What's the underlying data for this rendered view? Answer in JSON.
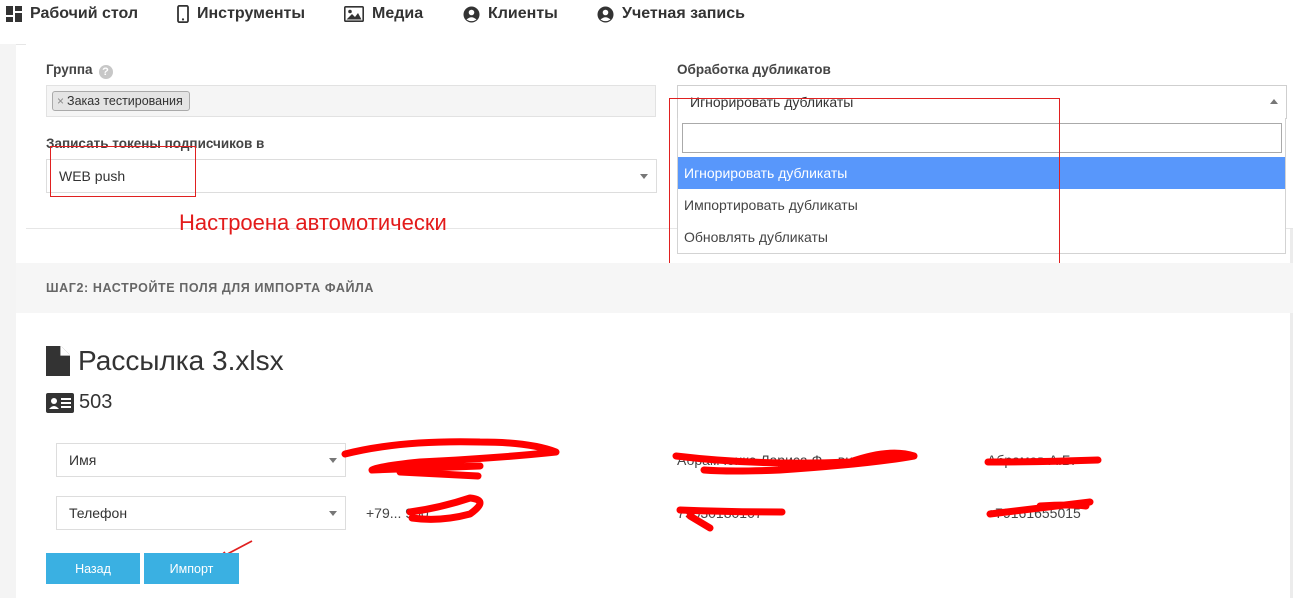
{
  "nav": {
    "items": [
      {
        "label": "Рабочий стол",
        "icon": "dashboard-icon"
      },
      {
        "label": "Инструменты",
        "icon": "mobile-icon"
      },
      {
        "label": "Медиа",
        "icon": "image-icon"
      },
      {
        "label": "Клиенты",
        "icon": "user-circle-icon"
      },
      {
        "label": "Учетная запись",
        "icon": "account-icon"
      }
    ]
  },
  "group": {
    "label": "Группа",
    "help": "?",
    "tag_remove": "×",
    "tag": "Заказ тестирования"
  },
  "tokens": {
    "label": "Записать токены подписчиков в",
    "value": "WEB push"
  },
  "duplicates": {
    "label": "Обработка дубликатов",
    "value": "Игнорировать дубликаты",
    "options": [
      "Игнорировать дубликаты",
      "Импортировать дубликаты",
      "Обновлять дубликаты"
    ]
  },
  "annotation": {
    "note": "Настроена автомотически"
  },
  "step2": {
    "title": "ШАГ2: НАСТРОЙТЕ ПОЛЯ ДЛЯ ИМПОРТА ФАЙЛА",
    "file_name": "Рассылка 3.xlsx",
    "count": "503"
  },
  "mapping": {
    "rows": [
      {
        "field": "Имя",
        "col1": "",
        "col2": "Абрамченко Лариса Ф... вна",
        "col3": "Абрамов А.Б."
      },
      {
        "field": "Телефон",
        "col1": "+79... 900",
        "col2": "79030180107",
        "col3": "+79161655015"
      }
    ]
  },
  "buttons": {
    "back": "Назад",
    "import": "Импорт"
  },
  "colors": {
    "accent_button": "#3ab0e2",
    "dropdown_active": "#5897fb",
    "annotation_red": "#e31b1b"
  }
}
